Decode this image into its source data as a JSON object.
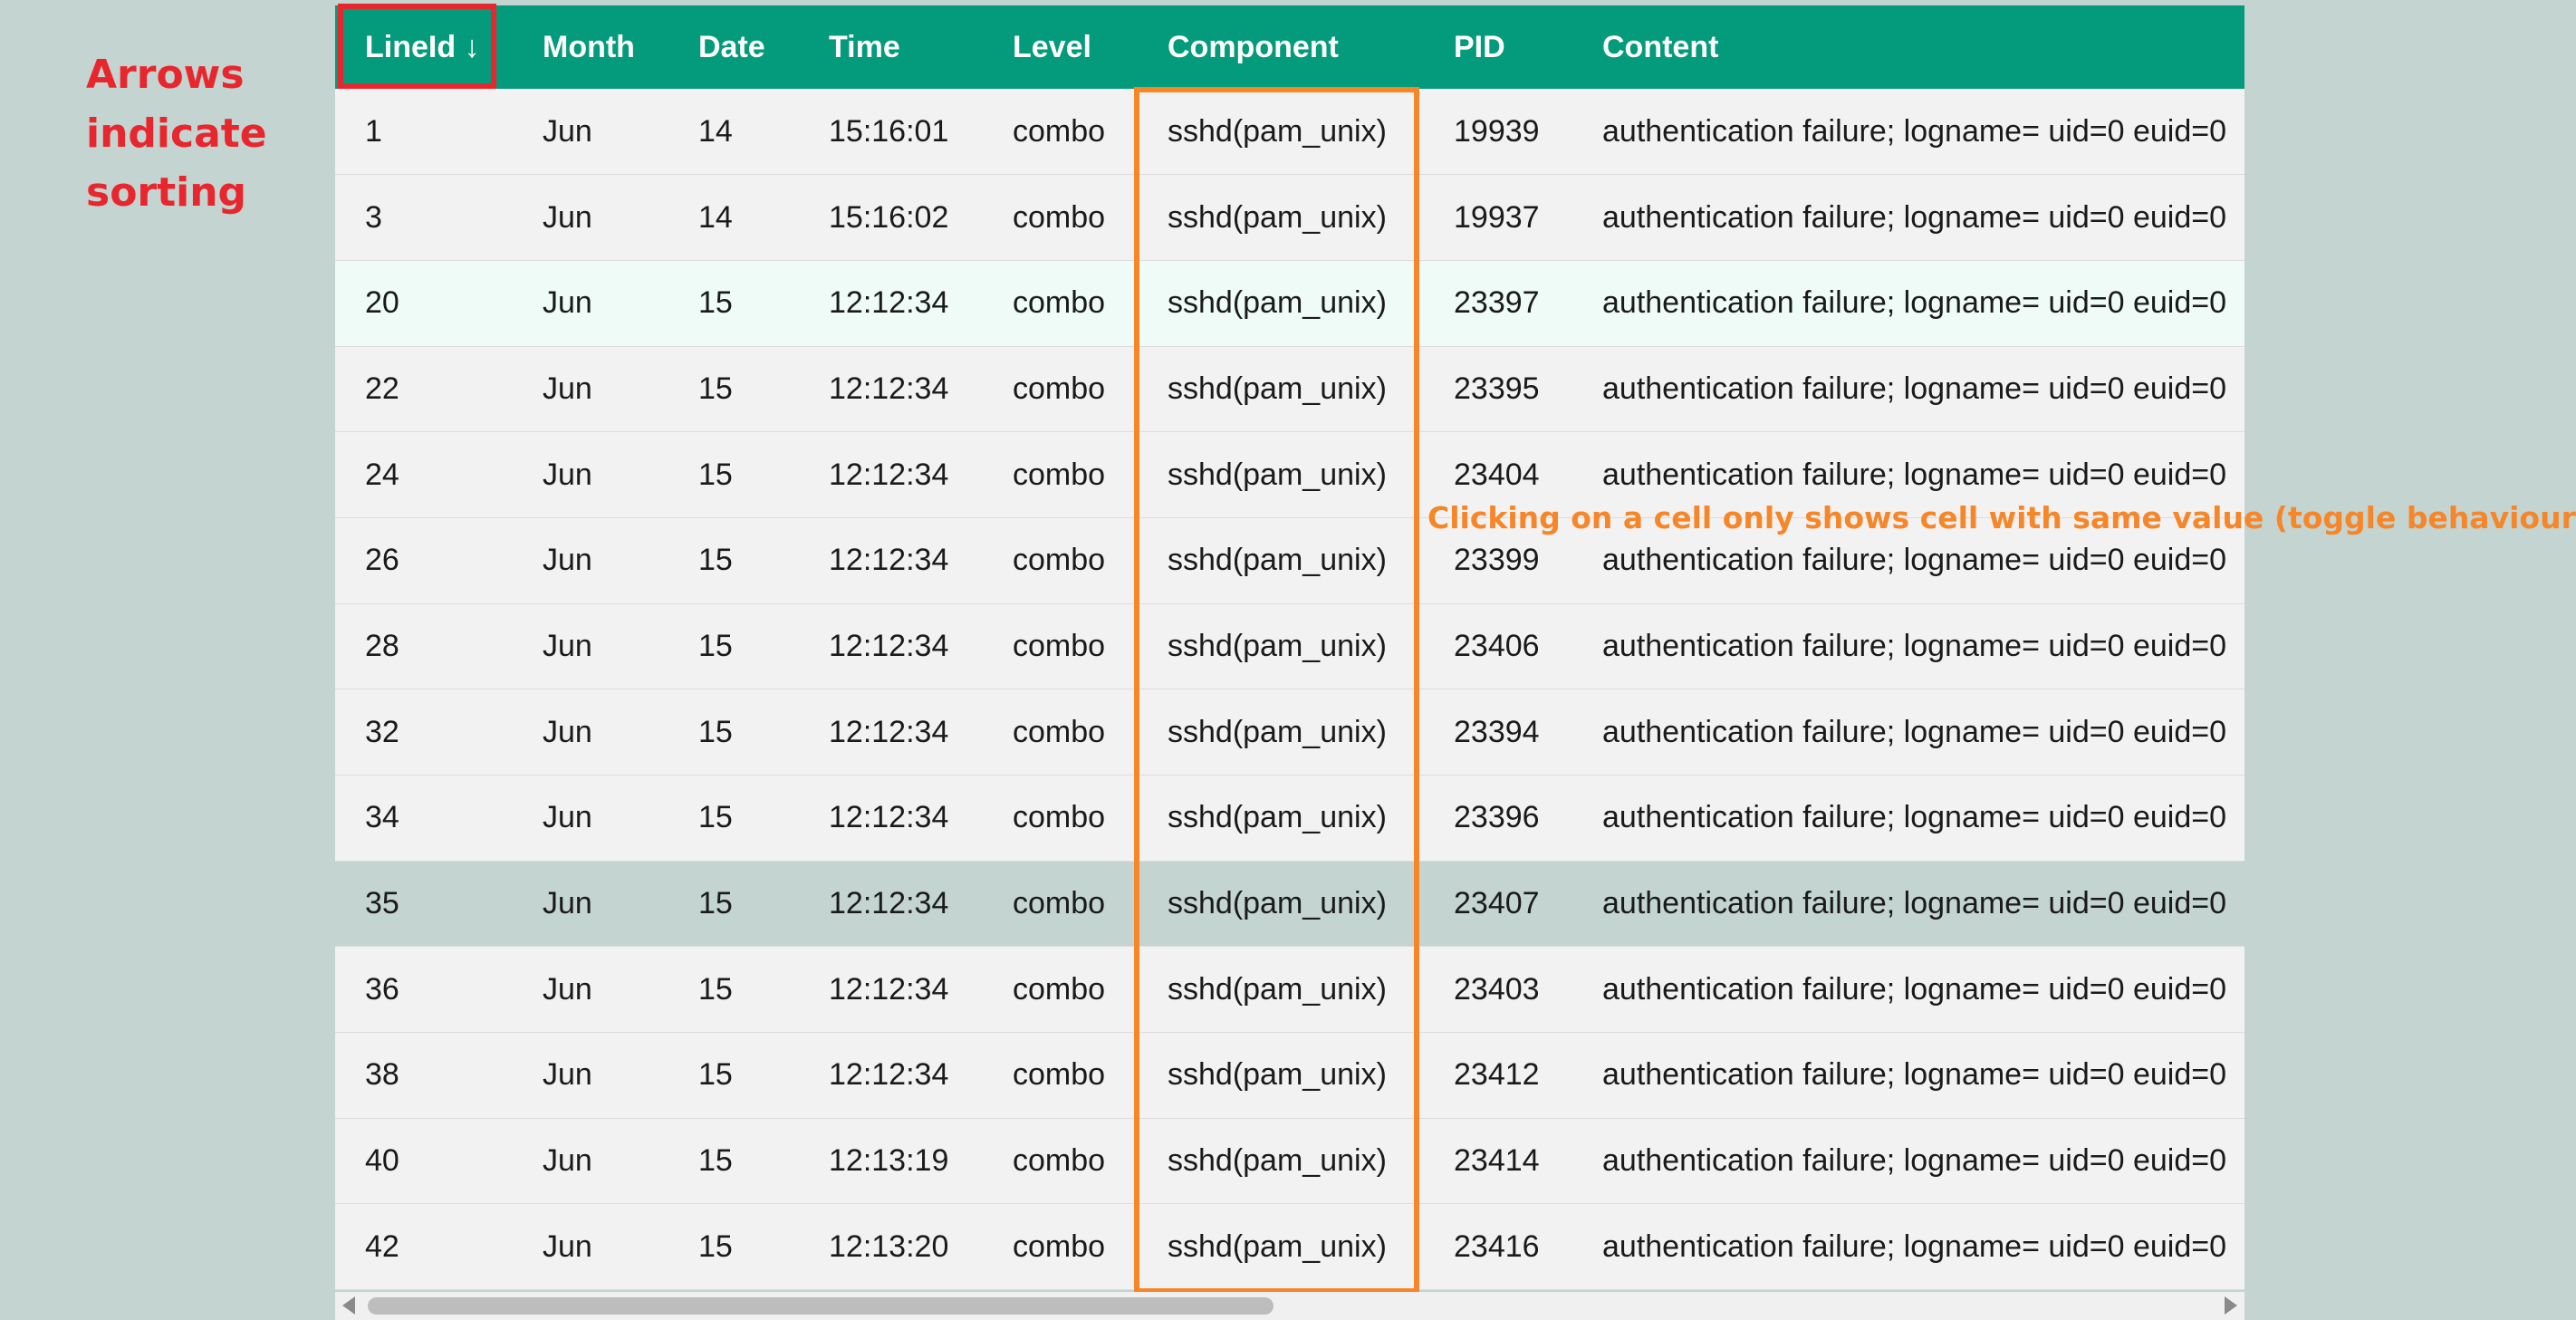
{
  "annotations": {
    "sorting_note": [
      "Arrows",
      "indicate",
      "sorting"
    ],
    "filter_note": "Clicking on a cell only shows cell with same value (toggle behaviour)"
  },
  "colors": {
    "header_bg": "#039b7b",
    "page_bg": "#c3d4d1",
    "sort_annotation": "#e8262d",
    "filter_annotation": "#f78628",
    "row_bg": "#f2f2f2",
    "row_highlight": "#effbf6"
  },
  "table": {
    "columns": [
      {
        "label": "LineId ↓",
        "key": "lineid"
      },
      {
        "label": "Month",
        "key": "month"
      },
      {
        "label": "Date",
        "key": "date"
      },
      {
        "label": "Time",
        "key": "time"
      },
      {
        "label": "Level",
        "key": "level"
      },
      {
        "label": "Component",
        "key": "component"
      },
      {
        "label": "PID",
        "key": "pid"
      },
      {
        "label": "Content",
        "key": "content"
      }
    ],
    "rows": [
      [
        "1",
        "Jun",
        "14",
        "15:16:01",
        "combo",
        "sshd(pam_unix)",
        "19939",
        "authentication failure; logname= uid=0 euid=0"
      ],
      [
        "3",
        "Jun",
        "14",
        "15:16:02",
        "combo",
        "sshd(pam_unix)",
        "19937",
        "authentication failure; logname= uid=0 euid=0"
      ],
      [
        "20",
        "Jun",
        "15",
        "12:12:34",
        "combo",
        "sshd(pam_unix)",
        "23397",
        "authentication failure; logname= uid=0 euid=0"
      ],
      [
        "22",
        "Jun",
        "15",
        "12:12:34",
        "combo",
        "sshd(pam_unix)",
        "23395",
        "authentication failure; logname= uid=0 euid=0"
      ],
      [
        "24",
        "Jun",
        "15",
        "12:12:34",
        "combo",
        "sshd(pam_unix)",
        "23404",
        "authentication failure; logname= uid=0 euid=0"
      ],
      [
        "26",
        "Jun",
        "15",
        "12:12:34",
        "combo",
        "sshd(pam_unix)",
        "23399",
        "authentication failure; logname= uid=0 euid=0"
      ],
      [
        "28",
        "Jun",
        "15",
        "12:12:34",
        "combo",
        "sshd(pam_unix)",
        "23406",
        "authentication failure; logname= uid=0 euid=0"
      ],
      [
        "32",
        "Jun",
        "15",
        "12:12:34",
        "combo",
        "sshd(pam_unix)",
        "23394",
        "authentication failure; logname= uid=0 euid=0"
      ],
      [
        "34",
        "Jun",
        "15",
        "12:12:34",
        "combo",
        "sshd(pam_unix)",
        "23396",
        "authentication failure; logname= uid=0 euid=0"
      ],
      [
        "35",
        "Jun",
        "15",
        "12:12:34",
        "combo",
        "sshd(pam_unix)",
        "23407",
        "authentication failure; logname= uid=0 euid=0"
      ],
      [
        "36",
        "Jun",
        "15",
        "12:12:34",
        "combo",
        "sshd(pam_unix)",
        "23403",
        "authentication failure; logname= uid=0 euid=0"
      ],
      [
        "38",
        "Jun",
        "15",
        "12:12:34",
        "combo",
        "sshd(pam_unix)",
        "23412",
        "authentication failure; logname= uid=0 euid=0"
      ],
      [
        "40",
        "Jun",
        "15",
        "12:13:19",
        "combo",
        "sshd(pam_unix)",
        "23414",
        "authentication failure; logname= uid=0 euid=0"
      ],
      [
        "42",
        "Jun",
        "15",
        "12:13:20",
        "combo",
        "sshd(pam_unix)",
        "23416",
        "authentication failure; logname= uid=0 euid=0"
      ]
    ],
    "highlighted_row_index": 2,
    "hovered_row_index": 9
  }
}
